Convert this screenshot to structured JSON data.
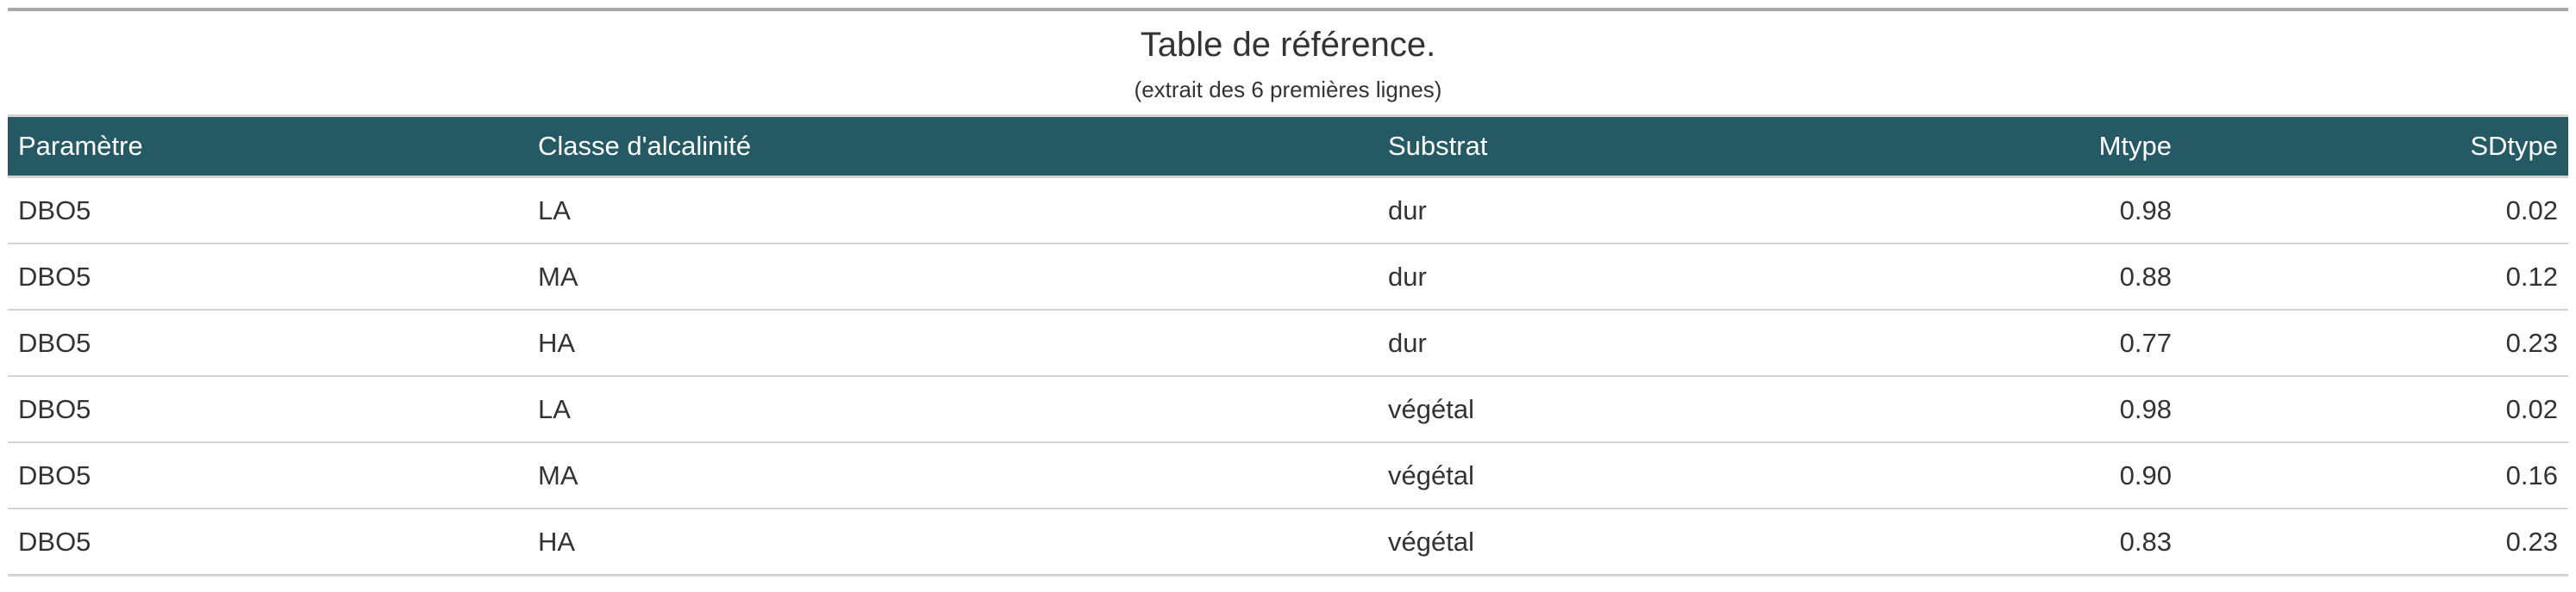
{
  "table": {
    "title": "Table de référence.",
    "subtitle": "(extrait des 6 premières lignes)",
    "columns": [
      {
        "label": "Paramètre",
        "align": "left"
      },
      {
        "label": "Classe d'alcalinité",
        "align": "left"
      },
      {
        "label": "Substrat",
        "align": "left"
      },
      {
        "label": "Mtype",
        "align": "right"
      },
      {
        "label": "SDtype",
        "align": "right"
      }
    ],
    "rows": [
      [
        "DBO5",
        "LA",
        "dur",
        "0.98",
        "0.02"
      ],
      [
        "DBO5",
        "MA",
        "dur",
        "0.88",
        "0.12"
      ],
      [
        "DBO5",
        "HA",
        "dur",
        "0.77",
        "0.23"
      ],
      [
        "DBO5",
        "LA",
        "végétal",
        "0.98",
        "0.02"
      ],
      [
        "DBO5",
        "MA",
        "végétal",
        "0.90",
        "0.16"
      ],
      [
        "DBO5",
        "HA",
        "végétal",
        "0.83",
        "0.23"
      ]
    ],
    "header_bg": "#255a65",
    "header_fg": "#ffffff",
    "rule_color": "#d3d3d3"
  }
}
